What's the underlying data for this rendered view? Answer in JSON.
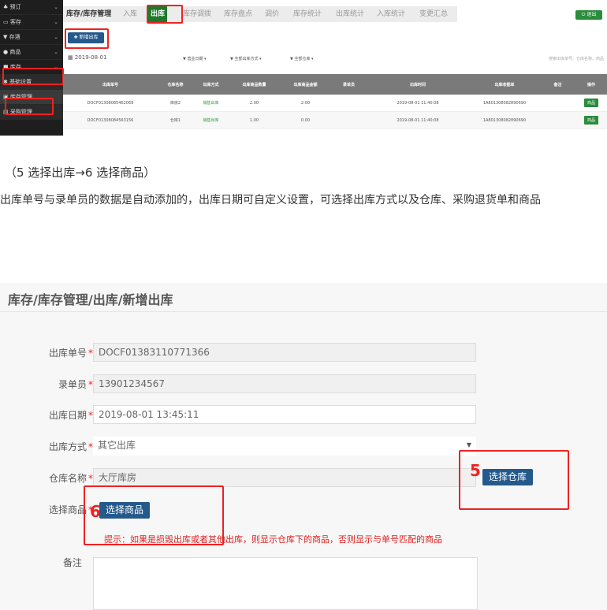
{
  "top": {
    "sidebar": [
      {
        "icon": "bell-icon",
        "label": "预订"
      },
      {
        "icon": "bed-icon",
        "label": "客存"
      },
      {
        "icon": "funnel-icon",
        "label": "存酒"
      },
      {
        "icon": "cart-icon",
        "label": "商品"
      },
      {
        "icon": "box-icon",
        "label": "库存"
      }
    ],
    "sub_items": [
      "基础设置",
      "库存管理",
      "采购管理"
    ],
    "tabs": [
      "库存/库存管理",
      "入库",
      "出库",
      "库存调拨",
      "库存盘点",
      "调价",
      "库存统计",
      "出库统计",
      "入库统计",
      "变更汇总"
    ],
    "exit_label": "退出",
    "new_button": "新增出库",
    "date_value": "2019-08-01",
    "filters": [
      "营业日期",
      "全部出库方式",
      "全部仓库"
    ],
    "search_placeholder": "搜索出库单号、仓库名称、商品",
    "columns": [
      "出库单号",
      "仓库名称",
      "出库方式",
      "出库商品数量",
      "出库商品金额",
      "录单员",
      "出库时间",
      "出库收据单",
      "备注",
      "操作"
    ],
    "rows": [
      {
        "no": "DOCF01308085462069",
        "warehouse": "库房2",
        "method": "销售出库",
        "qty": "2.00",
        "amount": "2.00",
        "clerk": "",
        "time": "2019-08-01 11:40:08",
        "receipt": "1A801308082890690",
        "remark": "",
        "op": "商品"
      },
      {
        "no": "DOCF01308084563156",
        "warehouse": "仓库1",
        "method": "销售出库",
        "qty": "1.00",
        "amount": "0.00",
        "clerk": "",
        "time": "2019-08-01 11:40:08",
        "receipt": "1A801308082890690",
        "remark": "",
        "op": "商品"
      }
    ]
  },
  "caption": "（5 选择出库→6 选择商品）",
  "paragraph": "出库单号与录单员的数据是自动添加的，出库日期可自定义设置，可选择出库方式以及仓库、采购退货单和商品",
  "form": {
    "title": "库存/库存管理/出库/新增出库",
    "fields": {
      "order_no": {
        "label": "出库单号",
        "value": "DOCF01383110771366"
      },
      "clerk": {
        "label": "录单员",
        "value": "13901234567"
      },
      "date": {
        "label": "出库日期",
        "value": "2019-08-01 13:45:11"
      },
      "method": {
        "label": "出库方式",
        "value": "其它出库"
      },
      "warehouse": {
        "label": "仓库名称",
        "value": "大厅库房"
      },
      "goods": {
        "label": "选择商品"
      },
      "remark": {
        "label": "备注"
      }
    },
    "select_warehouse_btn": "选择仓库",
    "select_goods_btn": "选择商品",
    "step5": "5",
    "step6": "6",
    "hint": "提示：如果是损毁出库或者其他出库，则显示仓库下的商品，否则显示与单号匹配的商品"
  }
}
